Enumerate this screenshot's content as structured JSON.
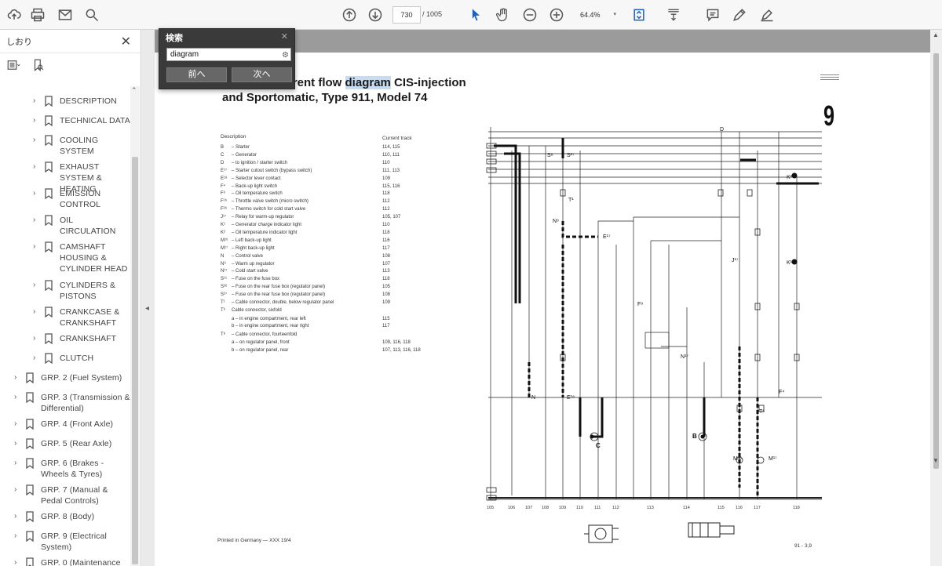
{
  "toolbar": {
    "page_current": "730",
    "page_total": "/ 1005",
    "zoom": "64.4%"
  },
  "sidebar": {
    "title": "しおり",
    "items": [
      {
        "label": "DESCRIPTION",
        "level": 2
      },
      {
        "label": "TECHNICAL DATA",
        "level": 2
      },
      {
        "label": "COOLING SYSTEM",
        "level": 2
      },
      {
        "label": "EXHAUST SYSTEM & HEATING",
        "level": 2
      },
      {
        "label": "EMISSION CONTROL",
        "level": 2
      },
      {
        "label": "OIL CIRCULATION",
        "level": 2
      },
      {
        "label": "CAMSHAFT HOUSING & CYLINDER HEAD",
        "level": 2
      },
      {
        "label": "CYLINDERS & PISTONS",
        "level": 2
      },
      {
        "label": "CRANKCASE & CRANKSHAFT",
        "level": 2
      },
      {
        "label": "CRANKSHAFT",
        "level": 2
      },
      {
        "label": "CLUTCH",
        "level": 2
      },
      {
        "label": "GRP. 2 (Fuel System)",
        "level": 1
      },
      {
        "label": "GRP. 3 (Transmission & Differential)",
        "level": 1
      },
      {
        "label": "GRP. 4 (Front Axle)",
        "level": 1
      },
      {
        "label": "GRP. 5 (Rear Axle)",
        "level": 1
      },
      {
        "label": "GRP. 6 (Brakes - Wheels & Tyres)",
        "level": 1
      },
      {
        "label": "GRP. 7 (Manual & Pedal Controls)",
        "level": 1
      },
      {
        "label": "GRP. 8 (Body)",
        "level": 1
      },
      {
        "label": "GRP. 9 (Electrical System)",
        "level": 1
      },
      {
        "label": "GRP. 0 (Maintenance",
        "level": 1
      }
    ]
  },
  "search": {
    "title": "検索",
    "query": "diagram",
    "prev_label": "前へ",
    "next_label": "次へ"
  },
  "document": {
    "title_line1_pre": "rrent flow ",
    "title_line1_hl": "diagram",
    "title_line1_post": " CIS-injection",
    "title_line2": "and Sportomatic, Type 911, Model 74",
    "group_number": "9",
    "description_header": "Description",
    "track_header": "Current track",
    "legend": [
      {
        "code": "B",
        "text": "– Starter",
        "track": "114, 115"
      },
      {
        "code": "C",
        "text": "– Generator",
        "track": "110, 111"
      },
      {
        "code": "D",
        "text": "– to ignition / starter switch",
        "track": "110"
      },
      {
        "code": "E¹⁷",
        "text": "– Starter cutout switch (bypass switch)",
        "track": "111, 113"
      },
      {
        "code": "E¹⁸",
        "text": "– Selector lever contact",
        "track": "109"
      },
      {
        "code": "F⁴",
        "text": "– Back-up light switch",
        "track": "115, 116"
      },
      {
        "code": "F⁹",
        "text": "– Oil temperature switch",
        "track": "118"
      },
      {
        "code": "F¹⁶",
        "text": "– Throttle valve switch (micro switch)",
        "track": "112"
      },
      {
        "code": "F²⁶",
        "text": "– Thermo switch for cold start valve",
        "track": "112"
      },
      {
        "code": "J¹⁷",
        "text": "– Relay for warm-up regulator",
        "track": "105, 107"
      },
      {
        "code": "K¹",
        "text": "– Generator charge indicator light",
        "track": "110"
      },
      {
        "code": "K²",
        "text": "– Oil temperature indicator light",
        "track": "118"
      },
      {
        "code": "M¹⁶",
        "text": "– Left back-up light",
        "track": "116"
      },
      {
        "code": "M¹⁷",
        "text": "– Right back-up light",
        "track": "117"
      },
      {
        "code": "N",
        "text": "– Control valve",
        "track": "108"
      },
      {
        "code": "N⁹",
        "text": "– Warm up regulator",
        "track": "107"
      },
      {
        "code": "N¹⁷",
        "text": "– Cold start valve",
        "track": "113"
      },
      {
        "code": "S¹¹",
        "text": "– Fuse on the fuse box",
        "track": "118"
      },
      {
        "code": "S²⁶",
        "text": "– Fuse on the rear fuse box (regulator panel)",
        "track": "105"
      },
      {
        "code": "S²⁷",
        "text": "– Fuse on the rear fuse box (regulator panel)",
        "track": "108"
      },
      {
        "code": "T¹",
        "text": "– Cable connector, double, below regulator panel",
        "track": "109"
      },
      {
        "code": "T⁶",
        "text": "Cable connector, sixfold",
        "track": ""
      },
      {
        "code": "",
        "text": "a – in engine compartment, rear left",
        "track": "115"
      },
      {
        "code": "",
        "text": "b – in engine compartment, rear right",
        "track": "117"
      },
      {
        "code": "T⁸",
        "text": "– Cable connector, fourteenfold",
        "track": ""
      },
      {
        "code": "",
        "text": "a – on regulator panel, front",
        "track": "109, 116, 118"
      },
      {
        "code": "",
        "text": "b – on regulator panel, rear",
        "track": "107, 113, 116, 118"
      }
    ],
    "footer_left": "Printed in Germany — XXX 19/4",
    "footer_right": "91 - 3,9",
    "diagram_labels": [
      "D",
      "S⁸",
      "S²⁷",
      "K²",
      "K¹",
      "N⁹",
      "E¹⁷",
      "J¹⁷",
      "C",
      "B",
      "M¹⁶",
      "M¹⁷",
      "F⁴",
      "F⁹",
      "N¹⁷",
      "E¹⁸",
      "T¹",
      "T⁶",
      "N"
    ],
    "track_numbers": [
      "105",
      "106",
      "107",
      "108",
      "109",
      "110",
      "111",
      "112",
      "113",
      "114",
      "115",
      "116",
      "117",
      "118"
    ]
  }
}
